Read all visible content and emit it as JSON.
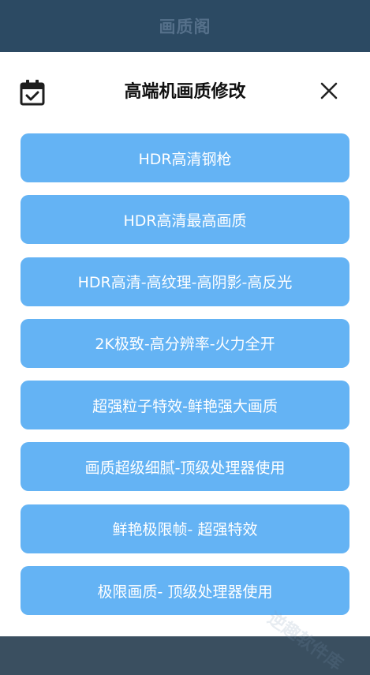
{
  "app": {
    "title": "画质阁"
  },
  "dialog": {
    "title": "高端机画质修改",
    "icon": "calendar-check-icon",
    "close_icon": "close-icon"
  },
  "options": [
    {
      "label": "HDR高清钢枪"
    },
    {
      "label": "HDR高清最高画质"
    },
    {
      "label": "HDR高清-高纹理-高阴影-高反光"
    },
    {
      "label": "2K极致-高分辨率-火力全开"
    },
    {
      "label": "超强粒子特效-鲜艳强大画质"
    },
    {
      "label": "画质超级细腻-顶级处理器使用"
    },
    {
      "label": "鲜艳极限帧- 超强特效"
    },
    {
      "label": "极限画质- 顶级处理器使用"
    }
  ],
  "watermark": "逆趣软件库",
  "colors": {
    "header_bg": "#2c4a63",
    "button_bg": "#64b3f4",
    "button_text": "#ffffff",
    "sheet_bg": "#ffffff"
  }
}
